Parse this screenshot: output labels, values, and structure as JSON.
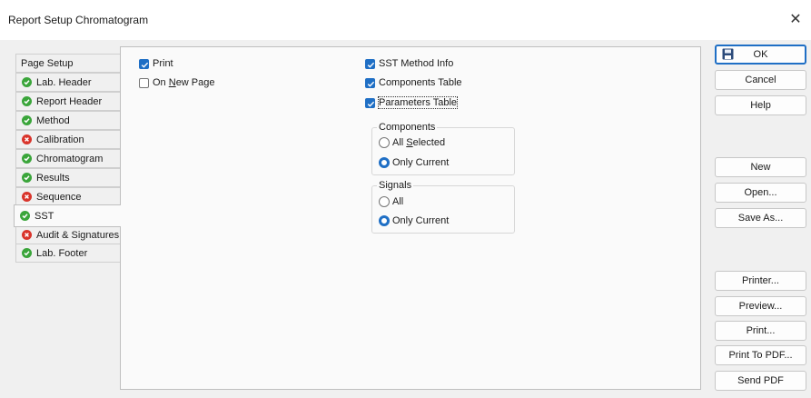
{
  "window": {
    "title": "Report Setup Chromatogram"
  },
  "tabs": [
    {
      "label": "Page Setup",
      "status": "none"
    },
    {
      "label": "Lab. Header",
      "status": "ok"
    },
    {
      "label": "Report Header",
      "status": "ok"
    },
    {
      "label": "Method",
      "status": "ok"
    },
    {
      "label": "Calibration",
      "status": "error"
    },
    {
      "label": "Chromatogram",
      "status": "ok"
    },
    {
      "label": "Results",
      "status": "ok"
    },
    {
      "label": "Sequence",
      "status": "error"
    },
    {
      "label": "SST",
      "status": "ok",
      "active": true
    },
    {
      "label": "Audit & Signatures",
      "status": "error"
    },
    {
      "label": "Lab. Footer",
      "status": "ok"
    }
  ],
  "options": {
    "print": {
      "label": "Print",
      "checked": true
    },
    "on_new_page": {
      "label_pre": "On ",
      "label_key": "N",
      "label_post": "ew Page",
      "checked": false
    },
    "sst_method_info": {
      "label": "SST Method Info",
      "checked": true
    },
    "components_table": {
      "label": "Components Table",
      "checked": true
    },
    "parameters_table": {
      "label": "Parameters Table",
      "checked": true
    }
  },
  "components_group": {
    "title": "Components",
    "all_selected": {
      "label_pre": "All ",
      "label_key": "S",
      "label_post": "elected",
      "selected": false
    },
    "only_current": {
      "label": "Only Current",
      "selected": true
    }
  },
  "signals_group": {
    "title": "Signals",
    "all": {
      "label": "All",
      "selected": false
    },
    "only_current": {
      "label": "Only Current",
      "selected": true
    }
  },
  "buttons": {
    "ok": "OK",
    "cancel": "Cancel",
    "help": "Help",
    "new": "New",
    "open": "Open...",
    "save_as": "Save As...",
    "printer": "Printer...",
    "preview": "Preview...",
    "print": "Print...",
    "print_to_pdf": "Print To PDF...",
    "send_pdf": "Send PDF"
  },
  "colors": {
    "accent": "#1f6fc5",
    "ok": "#3aa53a",
    "error": "#d9342b"
  }
}
